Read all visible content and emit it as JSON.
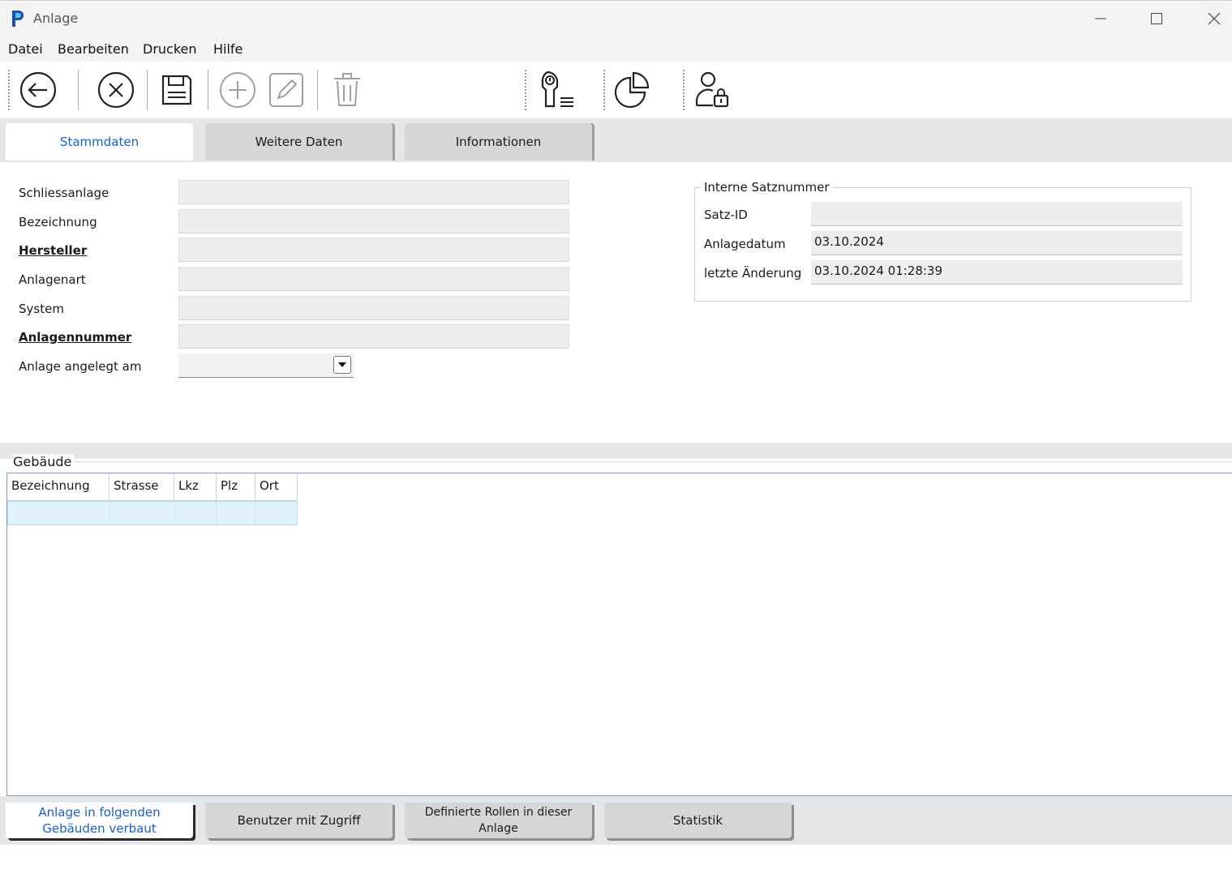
{
  "window": {
    "title": "Anlage",
    "accent": "#1a5fc9"
  },
  "menu": [
    "Datei",
    "Bearbeiten",
    "Drucken",
    "Hilfe"
  ],
  "toolbar": {
    "icons": [
      "back-arrow-icon",
      "cancel-icon",
      "save-icon",
      "add-icon",
      "edit-icon",
      "delete-icon",
      "key-list-icon",
      "pie-chart-icon",
      "user-lock-icon"
    ]
  },
  "tabs": [
    {
      "label": "Stammdaten",
      "active": true
    },
    {
      "label": "Weitere Daten",
      "active": false
    },
    {
      "label": "Informationen",
      "active": false
    }
  ],
  "form": {
    "schliessanlage": {
      "label": "Schliessanlage",
      "value": ""
    },
    "bezeichnung": {
      "label": "Bezeichnung",
      "value": ""
    },
    "hersteller": {
      "label": "Hersteller",
      "value": ""
    },
    "anlagenart": {
      "label": "Anlagenart",
      "value": ""
    },
    "system": {
      "label": "System",
      "value": ""
    },
    "anlagennummer": {
      "label": "Anlagennummer",
      "value": ""
    },
    "angelegt_am": {
      "label": "Anlage angelegt am",
      "value": ""
    }
  },
  "intern": {
    "title": "Interne Satznummer",
    "satz_id": {
      "label": "Satz-ID",
      "value": ""
    },
    "anlagedatum": {
      "label": "Anlagedatum",
      "value": "03.10.2024"
    },
    "letzte_aenderung": {
      "label": "letzte Änderung",
      "value": "03.10.2024 01:28:39"
    }
  },
  "gebaeude": {
    "title": "Gebäude",
    "columns": [
      "Bezeichnung",
      "Strasse",
      "Lkz",
      "Plz",
      "Ort"
    ]
  },
  "bottom_tabs": [
    {
      "label": "Anlage in folgenden Gebäuden verbaut",
      "active": true
    },
    {
      "label": "Benutzer mit Zugriff",
      "active": false
    },
    {
      "label": "Definierte Rollen in dieser Anlage",
      "active": false
    },
    {
      "label": "Statistik",
      "active": false
    }
  ]
}
